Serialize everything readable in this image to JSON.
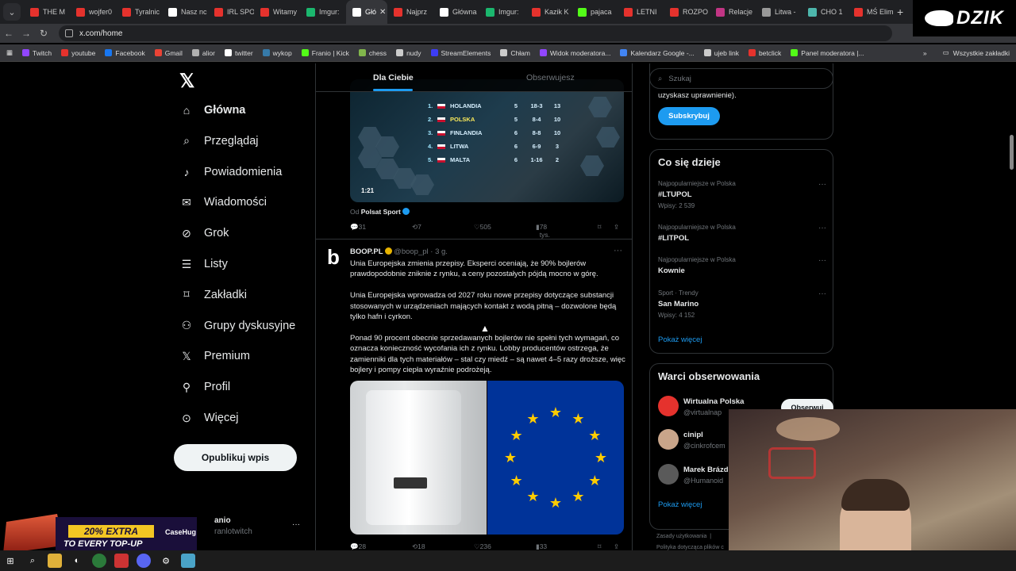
{
  "browser": {
    "tabs": [
      {
        "label": "THE M",
        "color": "#e5322d"
      },
      {
        "label": "wojfer0",
        "color": "#e5322d"
      },
      {
        "label": "Tyralnic",
        "color": "#e5322d"
      },
      {
        "label": "Nasz nc",
        "color": "#ffffff"
      },
      {
        "label": "IRL SPO",
        "color": "#e5322d"
      },
      {
        "label": "Witamy",
        "color": "#e5322d"
      },
      {
        "label": "Imgur:",
        "color": "#1bb76e"
      },
      {
        "label": "Głó",
        "color": "#ffffff",
        "active": true
      },
      {
        "label": "Najprz",
        "color": "#e5322d"
      },
      {
        "label": "Główna",
        "color": "#ffffff"
      },
      {
        "label": "Imgur:",
        "color": "#1bb76e"
      },
      {
        "label": "Kazik K",
        "color": "#e5322d"
      },
      {
        "label": "pajaca",
        "color": "#53fc18"
      },
      {
        "label": "LETNI",
        "color": "#e5322d"
      },
      {
        "label": "ROZPO",
        "color": "#e5322d"
      },
      {
        "label": "Relacje",
        "color": "#c13584"
      },
      {
        "label": "Litwa -",
        "color": "#999999"
      },
      {
        "label": "CHO 1",
        "color": "#4db6ac"
      },
      {
        "label": "MŚ Elim",
        "color": "#e5322d"
      }
    ],
    "url": "x.com/home",
    "bookmarks": [
      {
        "label": "Twitch",
        "color": "#9146ff"
      },
      {
        "label": "youtube",
        "color": "#e5322d"
      },
      {
        "label": "Facebook",
        "color": "#1877f2"
      },
      {
        "label": "Gmail",
        "color": "#ea4335"
      },
      {
        "label": "alior",
        "color": "#b0b0b0"
      },
      {
        "label": "twitter",
        "color": "#ffffff"
      },
      {
        "label": "wykop",
        "color": "#367aa9"
      },
      {
        "label": "Franio | Kick",
        "color": "#53fc18"
      },
      {
        "label": "chess",
        "color": "#81b64c"
      },
      {
        "label": "nudy",
        "color": "#cccccc"
      },
      {
        "label": "StreamElements",
        "color": "#3d3df5"
      },
      {
        "label": "Chłam",
        "color": "#cccccc"
      },
      {
        "label": "Widok moderatora...",
        "color": "#9146ff"
      },
      {
        "label": "Kalendarz Google -...",
        "color": "#4285f4"
      },
      {
        "label": "ujeb link",
        "color": "#cccccc"
      },
      {
        "label": "betclick",
        "color": "#e5322d"
      },
      {
        "label": "Panel moderatora |...",
        "color": "#53fc18"
      }
    ],
    "all_bookmarks": "Wszystkie zakładki",
    "overlay_brand": "DZIK"
  },
  "nav": {
    "items": [
      {
        "label": "Główna",
        "icon": "home-icon"
      },
      {
        "label": "Przeglądaj",
        "icon": "search-icon"
      },
      {
        "label": "Powiadomienia",
        "icon": "bell-icon"
      },
      {
        "label": "Wiadomości",
        "icon": "mail-icon"
      },
      {
        "label": "Grok",
        "icon": "grok-icon"
      },
      {
        "label": "Listy",
        "icon": "list-icon"
      },
      {
        "label": "Zakładki",
        "icon": "bookmark-icon"
      },
      {
        "label": "Grupy dyskusyjne",
        "icon": "people-icon"
      },
      {
        "label": "Premium",
        "icon": "x-icon"
      },
      {
        "label": "Profil",
        "icon": "person-icon"
      },
      {
        "label": "Więcej",
        "icon": "more-circle-icon"
      }
    ],
    "post_button": "Opublikuj wpis",
    "account_name": "anio",
    "account_handle": "ranlotwitch"
  },
  "feed": {
    "tab_for_you": "Dla Ciebie",
    "tab_following": "Obserwujesz",
    "video": {
      "time": "1:21",
      "rows": [
        {
          "pos": "1.",
          "team": "HOLANDIA",
          "m": "5",
          "g": "18-3",
          "p": "13"
        },
        {
          "pos": "2.",
          "team": "POLSKA",
          "m": "5",
          "g": "8-4",
          "p": "10",
          "highlight": true
        },
        {
          "pos": "3.",
          "team": "FINLANDIA",
          "m": "6",
          "g": "8-8",
          "p": "10"
        },
        {
          "pos": "4.",
          "team": "LITWA",
          "m": "6",
          "g": "6-9",
          "p": "3"
        },
        {
          "pos": "5.",
          "team": "MALTA",
          "m": "6",
          "g": "1-16",
          "p": "2"
        }
      ]
    },
    "source_prefix": "Od",
    "source_name": "Polsat Sport",
    "post1_actions": {
      "replies": "31",
      "reposts": "7",
      "likes": "505",
      "views": "78 tys."
    },
    "post2": {
      "author": "BOOP.PL",
      "handle": "@boop_pl",
      "time": "· 3 g.",
      "para1": "Unia Europejska zmienia przepisy. Eksperci oceniają, że 90% bojlerów prawdopodobnie zniknie z rynku, a ceny pozostałych pójdą mocno w górę.",
      "para2": "Unia Europejska wprowadza od 2027 roku nowe przepisy dotyczące substancji stosowanych w urządzeniach mających kontakt z wodą pitną – dozwolone będą tylko hafn i cyrkon.",
      "para3": "Ponad 90 procent obecnie sprzedawanych bojlerów nie spełni tych wymagań, co oznacza konieczność wycofania ich z rynku. Lobby producentów ostrzega, że zamienniki dla tych materiałów – stal czy miedź – są nawet 4–5 razy droższe, więc bojlery i pompy ciepła wyraźnie podrożeją.",
      "replies": "28",
      "reposts": "18",
      "likes": "236",
      "views": "33 tys."
    }
  },
  "sidebar": {
    "search_placeholder": "Szukaj",
    "premium_text": "funkcje i otrzymywać udział w dochodach (jeśli uzyskasz uprawnienie).",
    "subscribe": "Subskrybuj",
    "trends_title": "Co się dzieje",
    "trends": [
      {
        "context": "Najpopularniejsze w Polska",
        "name": "#LTUPOL",
        "posts": "Wpisy: 2 539"
      },
      {
        "context": "Najpopularniejsze w Polska",
        "name": "#LITPOL",
        "posts": ""
      },
      {
        "context": "Najpopularniejsze w Polska",
        "name": "Kownie",
        "posts": ""
      },
      {
        "context": "Sport · Trendy",
        "name": "San Marino",
        "posts": "Wpisy: 4 152"
      }
    ],
    "show_more": "Pokaż więcej",
    "follow_title": "Warci obserwowania",
    "follow": [
      {
        "name": "Wirtualna Polska",
        "handle": "@virtualnap",
        "color": "#e5322d"
      },
      {
        "name": "cinipl",
        "handle": "@cinkrofcem",
        "color": "#c9a58a"
      },
      {
        "name": "Marek Brázd",
        "handle": "@Humanoid",
        "color": "#5a5a5a"
      }
    ],
    "follow_button": "Obserwuj",
    "show_more2": "Pokaż więcej",
    "footer1": "Zasady użytkowania",
    "footer2": "Polityka dotycząca plików c"
  },
  "promo": {
    "line1": "20% EXTRA",
    "line2": "TO EVERY TOP-UP",
    "brand": "CaseHug"
  }
}
